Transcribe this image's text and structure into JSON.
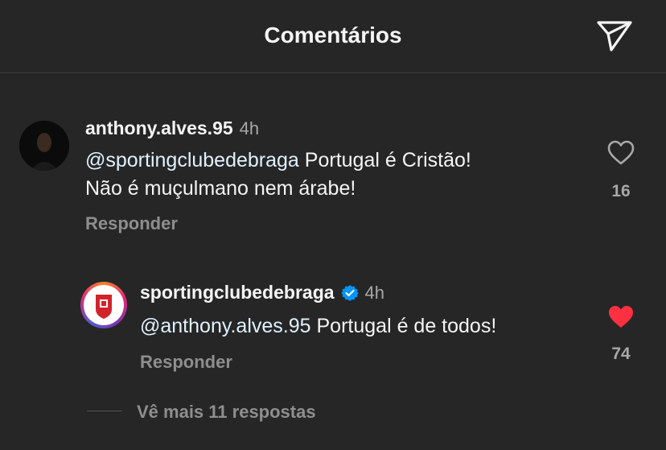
{
  "header": {
    "title": "Comentários",
    "share_icon": "send-icon"
  },
  "comments": [
    {
      "username": "anthony.alves.95",
      "time": "4h",
      "mention": "@sportingclubedebraga",
      "text_line1": " Portugal é Cristão!",
      "text_line2": "Não é muçulmano nem árabe!",
      "reply_label": "Responder",
      "likes": "16",
      "liked": false
    },
    {
      "username": "sportingclubedebraga",
      "verified": true,
      "time": "4h",
      "mention": "@anthony.alves.95",
      "text": " Portugal é de todos!",
      "reply_label": "Responder",
      "likes": "74",
      "liked": true
    }
  ],
  "more_replies": "Vê mais 11 respostas",
  "colors": {
    "background": "#262626",
    "heart_liked": "#ff3040",
    "verified": "#0095f6"
  }
}
